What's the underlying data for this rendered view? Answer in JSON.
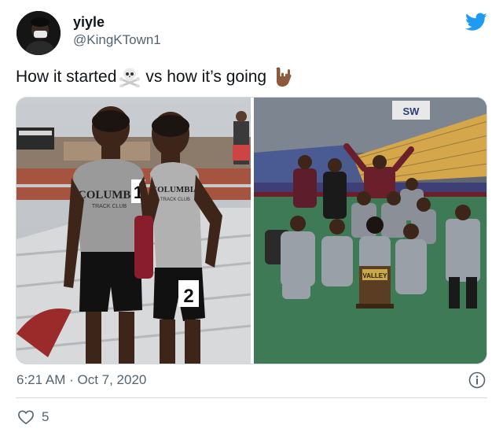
{
  "tweet": {
    "display_name": "yiyle",
    "handle": "@KingKTown1",
    "text_part1": "How it started",
    "text_part2": "vs how it’s going",
    "emoji1": "skull-and-crossbones-icon",
    "emoji2": "love-you-gesture-icon",
    "timestamp": "6:21 AM · Oct 7, 2020",
    "likes": "5"
  },
  "images": {
    "left": {
      "jersey1_text": "COLUMBIA",
      "jersey1_sub": "TRACK CLUB",
      "bib1": "1",
      "jersey2_text": "COLUMBIA",
      "jersey2_sub": "TRACK CLUB",
      "bib2": "2"
    },
    "right": {
      "scoreboard_text": "SW",
      "trophy_text": "VALLEY"
    }
  },
  "colors": {
    "twitter_blue": "#1d9bf0",
    "text_primary": "#0f1419",
    "text_secondary": "#536471",
    "border": "#cfd9de"
  }
}
